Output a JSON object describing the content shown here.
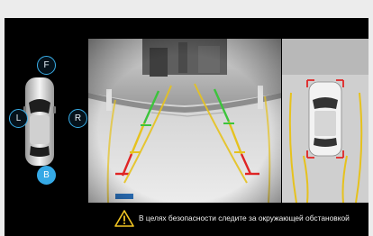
{
  "camera_buttons": {
    "front": "F",
    "left": "L",
    "right": "R",
    "back": "B",
    "active": "back"
  },
  "icons": {
    "car": "car-top-view-icon",
    "warning": "warning-triangle-icon"
  },
  "colors": {
    "accent": "#35a9e6",
    "guide_green": "#3cc43c",
    "guide_yellow": "#e6c21e",
    "guide_red": "#e02424",
    "warning_icon": "#f3c623"
  },
  "warning_text": "В целях безопасности следите за окружающей обстановкой"
}
